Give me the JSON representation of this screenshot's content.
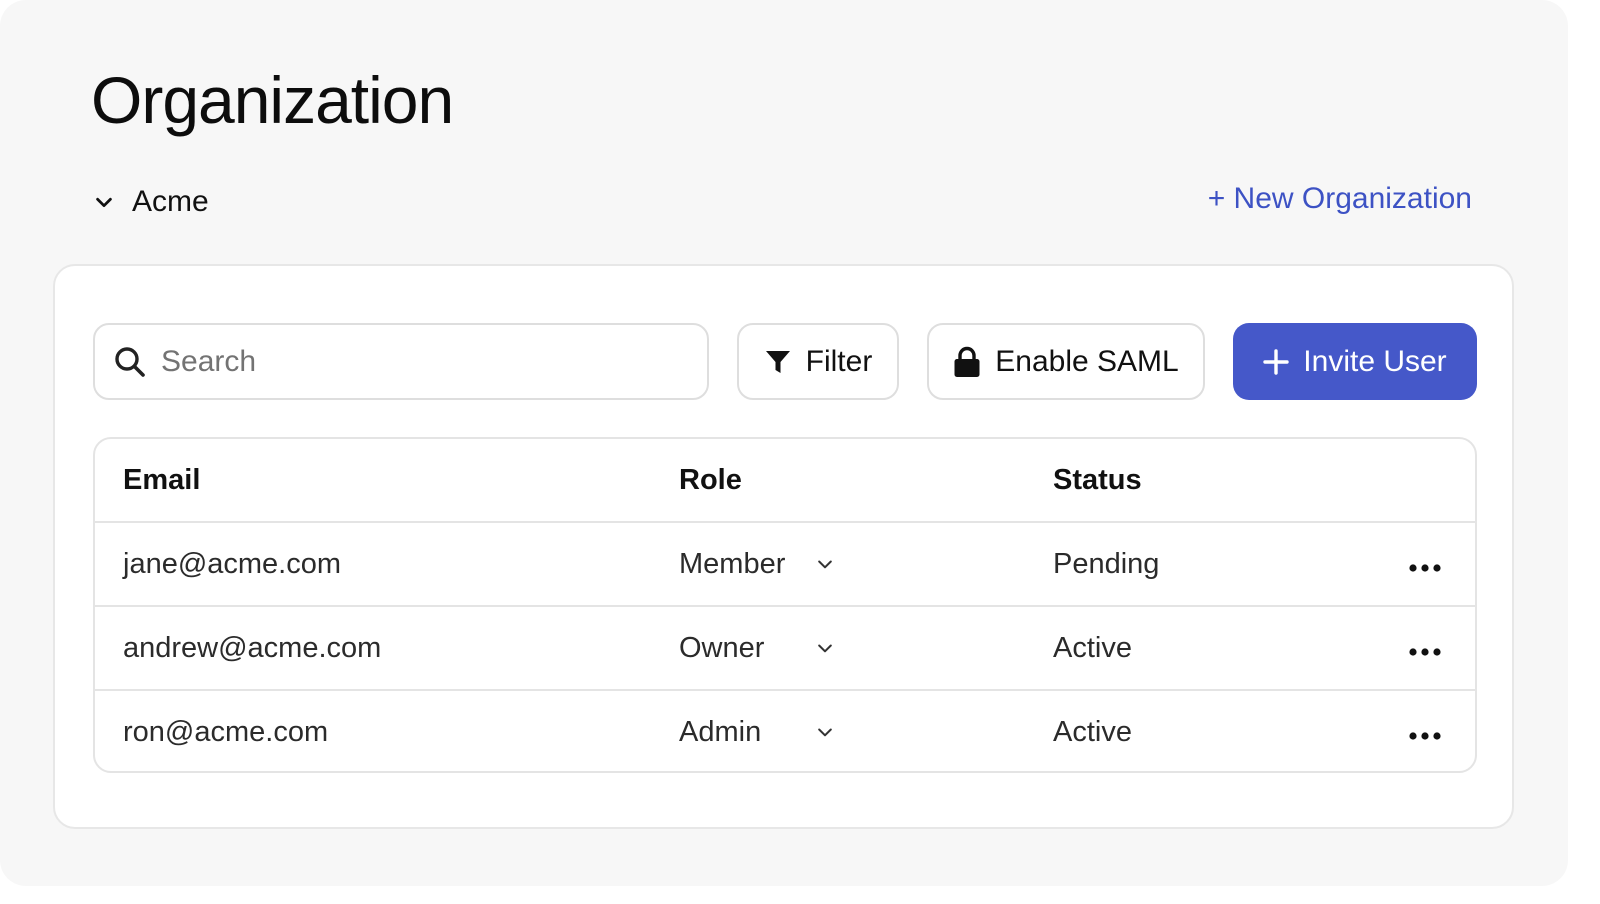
{
  "page": {
    "title": "Organization"
  },
  "org": {
    "name": "Acme",
    "new_link": "+ New Organization"
  },
  "toolbar": {
    "search_placeholder": "Search",
    "search_value": "",
    "filter_label": "Filter",
    "saml_label": "Enable SAML",
    "invite_label": "Invite User"
  },
  "table": {
    "headers": [
      "Email",
      "Role",
      "Status"
    ],
    "rows": [
      {
        "email": "jane@acme.com",
        "role": "Member",
        "status": "Pending"
      },
      {
        "email": "andrew@acme.com",
        "role": "Owner",
        "status": "Active"
      },
      {
        "email": "ron@acme.com",
        "role": "Admin",
        "status": "Active"
      }
    ]
  },
  "icons": {
    "org_toggle": "chevron-down-icon",
    "search": "search-icon",
    "filter": "filter-icon",
    "saml": "lock-icon",
    "invite": "plus-icon",
    "role_select": "chevron-down-icon",
    "row_actions": "more-horizontal-icon"
  },
  "colors": {
    "accent": "#4558c9",
    "link": "#3d52c4",
    "background": "#f7f7f7",
    "card": "#ffffff",
    "border": "#e4e4e4"
  }
}
